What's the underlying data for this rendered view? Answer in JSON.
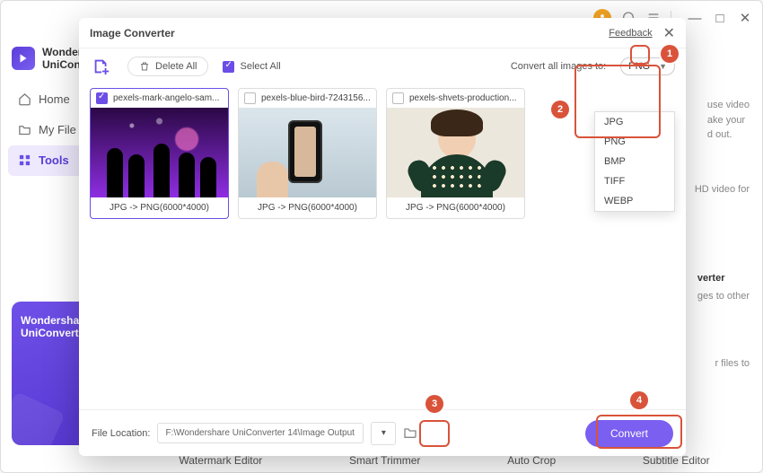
{
  "titlebar": {
    "minimize": "—",
    "maximize": "□",
    "close": "✕"
  },
  "brand": {
    "line1": "Wonders",
    "line2": "UniCon"
  },
  "nav": {
    "home": "Home",
    "myfiles": "My File",
    "tools": "Tools"
  },
  "promo": {
    "line1": "Wondersha",
    "line2": "UniConvert"
  },
  "bottomTools": {
    "watermark": "Watermark Editor",
    "trimmer": "Smart Trimmer",
    "autocrop": "Auto Crop",
    "subtitle": "Subtitle Editor"
  },
  "bgHints": {
    "h1a": "use video",
    "h1b": "ake your",
    "h1c": "d out.",
    "h2": "HD video for",
    "h3a": "verter",
    "h3b": "ges to other",
    "h4": "r files to"
  },
  "modal": {
    "title": "Image Converter",
    "feedback": "Feedback",
    "deleteAll": "Delete All",
    "selectAll": "Select All",
    "convertLabel": "Convert all images to:",
    "selectedFormat": "PNG",
    "formats": [
      "JPG",
      "PNG",
      "BMP",
      "TIFF",
      "WEBP"
    ],
    "cards": [
      {
        "name": "pexels-mark-angelo-sam...",
        "foot": "JPG -> PNG(6000*4000)",
        "checked": true
      },
      {
        "name": "pexels-blue-bird-7243156...",
        "foot": "JPG -> PNG(6000*4000)",
        "checked": false
      },
      {
        "name": "pexels-shvets-production...",
        "foot": "JPG -> PNG(6000*4000)",
        "checked": false
      }
    ],
    "fileLocationLabel": "File Location:",
    "fileLocationPath": "F:\\Wondershare UniConverter 14\\Image Output",
    "convertBtn": "Convert"
  },
  "badges": {
    "b1": "1",
    "b2": "2",
    "b3": "3",
    "b4": "4"
  }
}
